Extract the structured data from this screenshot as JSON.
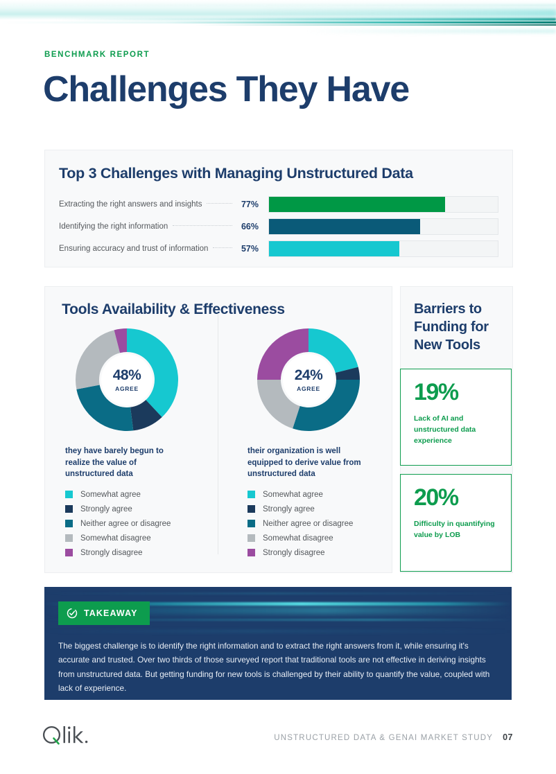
{
  "header": {
    "eyebrow": "BENCHMARK REPORT",
    "title": "Challenges They Have"
  },
  "bar_section": {
    "title": "Top 3 Challenges with Managing Unstructured Data"
  },
  "tools_section": {
    "title": "Tools Availability & Effectiveness"
  },
  "barriers": {
    "title": "Barriers to Funding for New Tools",
    "stats": [
      {
        "value": "19%",
        "description": "Lack of AI and unstructured data experience"
      },
      {
        "value": "20%",
        "description": "Difficulty in quantifying value by LOB"
      }
    ]
  },
  "takeaway": {
    "badge_label": "TAKEAWAY",
    "text": "The biggest challenge is to identify the right information and to extract the right answers from it, while ensuring it's accurate and trusted. Over two thirds of those surveyed report that traditional tools are not effective in deriving insights from unstructured data. But getting funding for new tools is challenged by their ability to quantify the value, coupled with lack of experience."
  },
  "footer": {
    "logo": "Qlik.",
    "study": "UNSTRUCTURED DATA & GENAI MARKET STUDY",
    "page": "07"
  },
  "colors": {
    "brand_green": "#0d9c4e",
    "brand_navy": "#1d3d6b",
    "cyan": "#16c8d0",
    "teal": "#0a5a78",
    "gray": "#b4babe",
    "purple": "#9b4ca0",
    "navy_dark": "#1b3a5c"
  },
  "chart_data": [
    {
      "type": "bar",
      "title": "Top 3 Challenges with Managing Unstructured Data",
      "orientation": "horizontal",
      "categories": [
        "Extracting the right answers and insights",
        "Identifying the right information",
        "Ensuring accuracy and trust of information"
      ],
      "values": [
        77,
        66,
        57
      ],
      "value_labels": [
        "77%",
        "66%",
        "57%"
      ],
      "colors": [
        "#009845",
        "#0a5a78",
        "#16c8d0"
      ],
      "xlabel": "",
      "ylabel": "",
      "xlim": [
        0,
        100
      ],
      "grid": false,
      "legend": "none"
    },
    {
      "type": "pie",
      "subtype": "donut",
      "title": "Tools Availability & Effectiveness",
      "center_value": "48%",
      "center_label": "AGREE",
      "caption": "they have barely begun to realize the value of unstructured data",
      "categories": [
        "Somewhat agree",
        "Strongly agree",
        "Neither agree or disagree",
        "Somewhat disagree",
        "Strongly disagree"
      ],
      "values": [
        38,
        10,
        24,
        24,
        4
      ],
      "colors": [
        "#16c8d0",
        "#1b3a5c",
        "#0a6c86",
        "#b4babe",
        "#9b4ca0"
      ],
      "legend": "bottom"
    },
    {
      "type": "pie",
      "subtype": "donut",
      "title": "Tools Availability & Effectiveness",
      "center_value": "24%",
      "center_label": "AGREE",
      "caption": "their organization is well equipped to derive value from unstructured data",
      "categories": [
        "Somewhat agree",
        "Strongly agree",
        "Neither agree or disagree",
        "Somewhat disagree",
        "Strongly disagree"
      ],
      "values": [
        21,
        4,
        30,
        20,
        25
      ],
      "colors": [
        "#16c8d0",
        "#1b3a5c",
        "#0a6c86",
        "#b4babe",
        "#9b4ca0"
      ],
      "legend": "bottom"
    }
  ]
}
